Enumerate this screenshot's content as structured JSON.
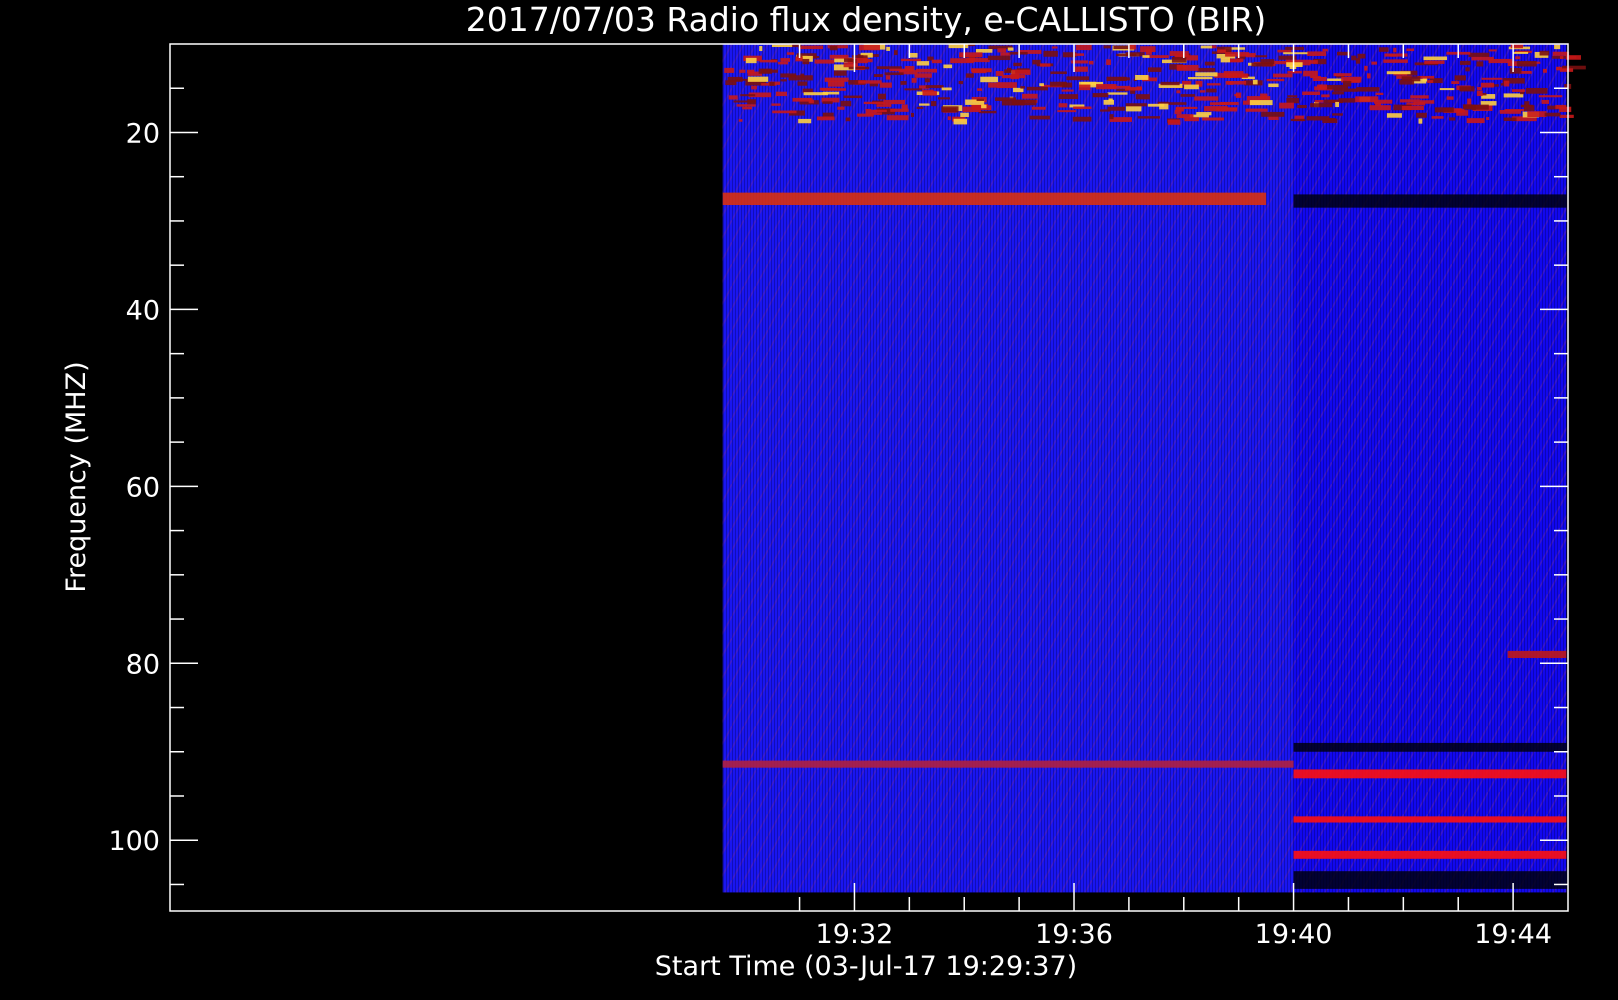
{
  "chart_data": {
    "type": "heatmap",
    "title": "2017/07/03  Radio flux density, e-CALLISTO (BIR)",
    "xlabel": "Start Time (03-Jul-17 19:29:37)",
    "ylabel": "Frequency (MHZ)",
    "x_range_minutes": [
      19.53,
      45.0
    ],
    "x_major_ticks": [
      {
        "label": "19:32",
        "minute": 32
      },
      {
        "label": "19:36",
        "minute": 36
      },
      {
        "label": "19:40",
        "minute": 40
      },
      {
        "label": "19:44",
        "minute": 44
      }
    ],
    "x_minor_tick_minutes": [
      31,
      33,
      34,
      35,
      37,
      38,
      39,
      41,
      42,
      43
    ],
    "ylim": [
      108,
      10
    ],
    "y_major_ticks": [
      {
        "label": "20",
        "value": 20
      },
      {
        "label": "40",
        "value": 40
      },
      {
        "label": "60",
        "value": 60
      },
      {
        "label": "80",
        "value": 80
      },
      {
        "label": "100",
        "value": 100
      }
    ],
    "y_minor_tick_values": [
      15,
      25,
      30,
      35,
      45,
      50,
      55,
      65,
      70,
      75,
      85,
      90,
      95,
      105
    ],
    "data_extent": {
      "time_start": 29.6,
      "time_end": 44.97,
      "freq_min": 10.0,
      "freq_max": 105.9
    },
    "segments": [
      {
        "time_start": 29.6,
        "time_end": 40.0,
        "background": "#1a16f0"
      },
      {
        "time_start": 40.0,
        "time_end": 44.97,
        "background": "#1208ee"
      }
    ],
    "emission_bands": [
      {
        "time_start": 29.6,
        "time_end": 44.97,
        "freq_from": 10.0,
        "freq_to": 19.0,
        "color": "#c81818",
        "level": "high"
      },
      {
        "time_start": 29.6,
        "time_end": 39.5,
        "freq_from": 26.8,
        "freq_to": 28.2,
        "color": "#d83010",
        "level": "high"
      },
      {
        "time_start": 29.6,
        "time_end": 40.0,
        "freq_from": 91.0,
        "freq_to": 91.8,
        "color": "#b02040",
        "level": "medium"
      },
      {
        "time_start": 40.0,
        "time_end": 44.97,
        "freq_from": 92.0,
        "freq_to": 93.0,
        "color": "#ff1010",
        "level": "high"
      },
      {
        "time_start": 40.0,
        "time_end": 44.97,
        "freq_from": 97.3,
        "freq_to": 98.0,
        "color": "#ff1010",
        "level": "high"
      },
      {
        "time_start": 40.0,
        "time_end": 44.97,
        "freq_from": 101.2,
        "freq_to": 102.1,
        "color": "#ff1010",
        "level": "high"
      },
      {
        "time_start": 43.9,
        "time_end": 44.97,
        "freq_from": 78.6,
        "freq_to": 79.4,
        "color": "#c01818",
        "level": "medium"
      }
    ],
    "quiet_bands": [
      {
        "time_start": 40.0,
        "time_end": 44.97,
        "freq_from": 27.0,
        "freq_to": 28.5
      },
      {
        "time_start": 40.0,
        "time_end": 44.97,
        "freq_from": 89.0,
        "freq_to": 90.0
      },
      {
        "time_start": 40.0,
        "time_end": 44.97,
        "freq_from": 103.5,
        "freq_to": 105.5
      }
    ],
    "colors": {
      "background": "#000000",
      "axes": "#ffffff",
      "text": "#ffffff"
    }
  }
}
